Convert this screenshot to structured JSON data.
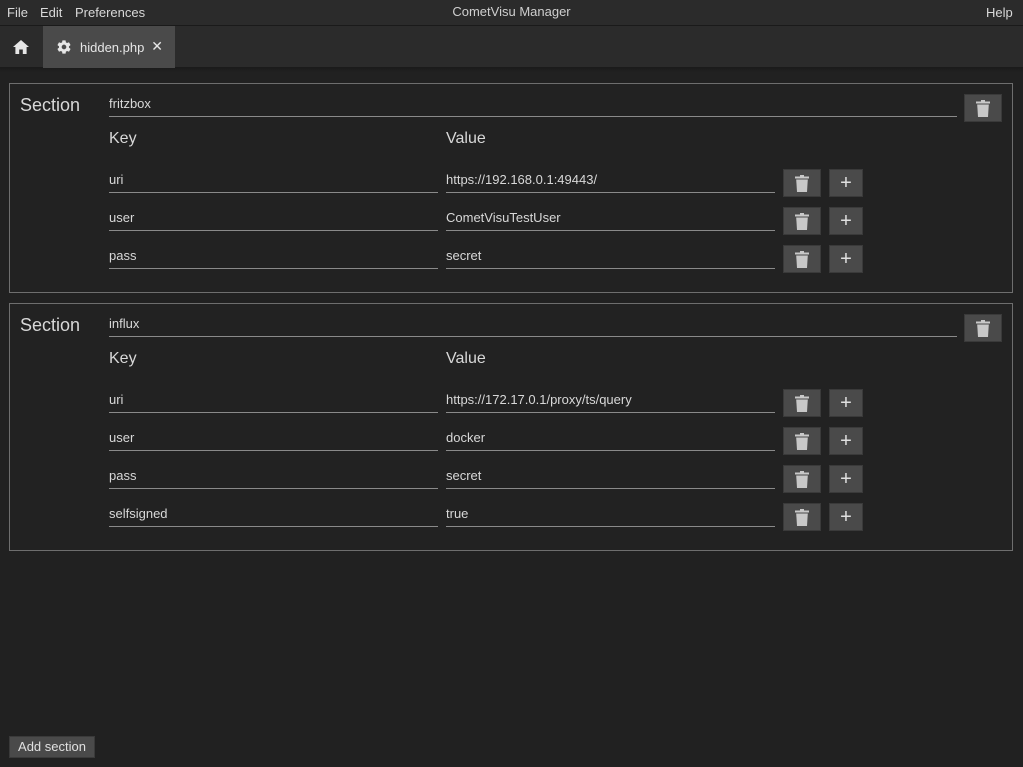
{
  "menu": {
    "file": "File",
    "edit": "Edit",
    "preferences": "Preferences",
    "help": "Help"
  },
  "app_title": "CometVisu Manager",
  "tabs": {
    "home_icon": "home-icon",
    "active_tab": {
      "label": "hidden.php",
      "icon": "gear-icon",
      "close": "✕"
    }
  },
  "labels": {
    "section": "Section",
    "key": "Key",
    "value": "Value"
  },
  "sections": [
    {
      "name": "fritzbox",
      "entries": [
        {
          "key": "uri",
          "value": "https://192.168.0.1:49443/"
        },
        {
          "key": "user",
          "value": "CometVisuTestUser"
        },
        {
          "key": "pass",
          "value": "secret"
        }
      ]
    },
    {
      "name": "influx",
      "entries": [
        {
          "key": "uri",
          "value": "https://172.17.0.1/proxy/ts/query"
        },
        {
          "key": "user",
          "value": "docker"
        },
        {
          "key": "pass",
          "value": "secret"
        },
        {
          "key": "selfsigned",
          "value": "true"
        }
      ]
    }
  ],
  "buttons": {
    "add_row": "+",
    "add_section": "Add section",
    "delete_icon": "trash-icon"
  }
}
